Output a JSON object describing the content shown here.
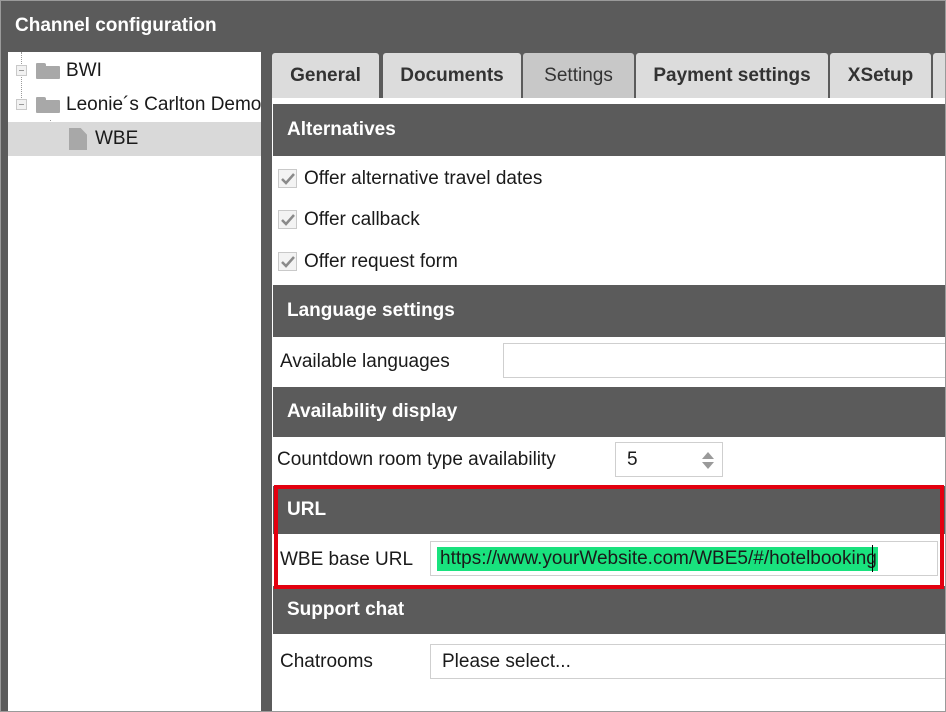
{
  "window": {
    "title": "Channel configuration"
  },
  "tree": {
    "nodes": [
      {
        "label": "BWI"
      },
      {
        "label": "Leonie´s Carlton Demo"
      },
      {
        "label": "WBE"
      }
    ]
  },
  "tabs": [
    {
      "label": "General"
    },
    {
      "label": "Documents"
    },
    {
      "label": "Settings"
    },
    {
      "label": "Payment settings"
    },
    {
      "label": "XSetup"
    }
  ],
  "sections": {
    "alternatives": {
      "header": "Alternatives",
      "options": [
        {
          "label": "Offer alternative travel dates",
          "checked": true
        },
        {
          "label": "Offer callback",
          "checked": true
        },
        {
          "label": "Offer request form",
          "checked": true
        }
      ]
    },
    "language": {
      "header": "Language settings",
      "available_label": "Available languages",
      "available_value": ""
    },
    "availability": {
      "header": "Availability display",
      "countdown_label": "Countdown room type availability",
      "countdown_value": "5"
    },
    "url": {
      "header": "URL",
      "base_label": "WBE base URL",
      "base_value": "https://www.yourWebsite.com/WBE5/#/hotelbooking"
    },
    "support": {
      "header": "Support chat",
      "chatrooms_label": "Chatrooms",
      "chatrooms_value": "Please select..."
    }
  },
  "colors": {
    "header_bg": "#5b5b5b",
    "selection_highlight": "#19e27e",
    "annotation_border": "#e3000f"
  }
}
